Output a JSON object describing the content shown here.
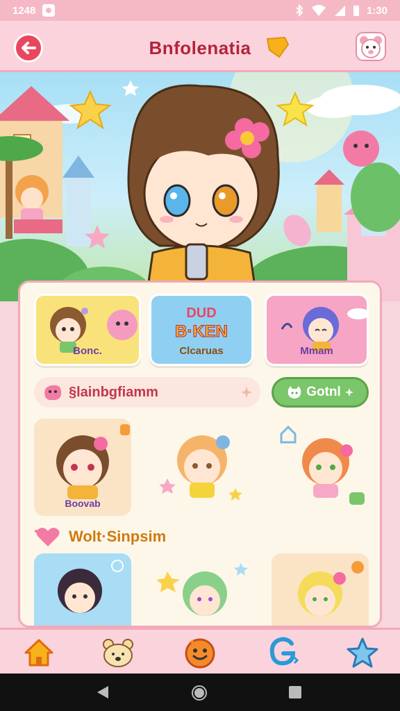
{
  "status_bar": {
    "time": "1248",
    "right_time": "1:30"
  },
  "app_bar": {
    "title": "Bnfolenatia"
  },
  "features": [
    {
      "label": "Bonc."
    },
    {
      "label": "Clcaruas",
      "sign_top": "DUD",
      "sign_bottom": "B·KEN"
    },
    {
      "label": "Mmam"
    }
  ],
  "search": {
    "text": "§lainbgfiamm"
  },
  "goto_button": {
    "label": "Gotnl"
  },
  "stickers_row1": [
    {
      "label": "Boovab"
    },
    {
      "label": ""
    },
    {
      "label": ""
    }
  ],
  "section": {
    "title": "Wolt·Sinpsim"
  },
  "colors": {
    "accent": "#e8475e",
    "brand_title": "#b3243b",
    "nav_bg": "#fbd3dc",
    "action_green": "#7bc56b"
  },
  "icons": {
    "back": "arrow-left-icon",
    "tag": "price-tag-icon",
    "bear": "bear-face-icon",
    "nav": [
      "home-icon",
      "bear-icon",
      "smile-face-icon",
      "sticker-g-icon",
      "star-icon"
    ]
  }
}
